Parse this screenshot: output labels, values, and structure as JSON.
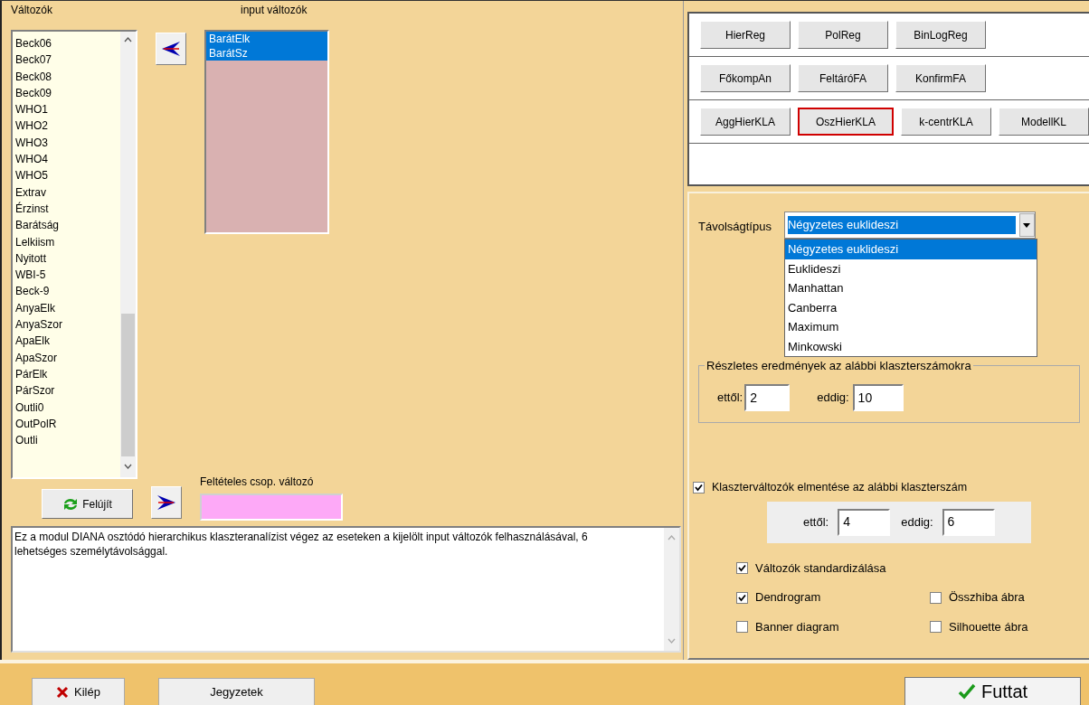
{
  "variables": {
    "label": "Változók",
    "items": [
      "Beck06",
      "Beck07",
      "Beck08",
      "Beck09",
      "WHO1",
      "WHO2",
      "WHO3",
      "WHO4",
      "WHO5",
      "Extrav",
      "Érzinst",
      "Barátság",
      "Lelkiism",
      "Nyitott",
      "WBI-5",
      "Beck-9",
      "AnyaElk",
      "AnyaSzor",
      "ApaElk",
      "ApaSzor",
      "PárElk",
      "PárSzor",
      "Outli0",
      "OutPolR",
      "Outli"
    ]
  },
  "input_variables": {
    "label": "input változók",
    "items": [
      {
        "text": "BarátElk",
        "selected": true
      },
      {
        "text": "BarátSz",
        "selected": true
      }
    ]
  },
  "condition": {
    "label": "Feltételes csop. változó"
  },
  "refresh_button": "Felújít",
  "description": "Ez a modul DIANA osztódó hierarchikus klaszteranalízist végez az eseteken a kijelölt input változók felhasználásával, 6 lehetséges személytávolsággal.",
  "module_rows": [
    [
      {
        "label": "HierReg",
        "selected": false
      },
      {
        "label": "PolReg",
        "selected": false
      },
      {
        "label": "BinLogReg",
        "selected": false
      }
    ],
    [
      {
        "label": "FőkompAn",
        "selected": false
      },
      {
        "label": "FeltáróFA",
        "selected": false
      },
      {
        "label": "KonfirmFA",
        "selected": false
      }
    ],
    [
      {
        "label": "AggHierKLA",
        "selected": false
      },
      {
        "label": "OszHierKLA",
        "selected": true
      },
      {
        "label": "k-centrKLA",
        "selected": false
      },
      {
        "label": "ModellKL",
        "selected": false
      }
    ]
  ],
  "distance": {
    "label": "Távolságtípus",
    "value": "Négyzetes euklideszi",
    "expanded": true,
    "options": [
      {
        "label": "Négyzetes euklideszi",
        "selected": true
      },
      {
        "label": "Euklideszi",
        "selected": false
      },
      {
        "label": "Manhattan",
        "selected": false
      },
      {
        "label": "Canberra",
        "selected": false
      },
      {
        "label": "Maximum",
        "selected": false
      },
      {
        "label": "Minkowski",
        "selected": false
      }
    ]
  },
  "details_group": {
    "title": "Részletes eredmények az alábbi klaszterszámokra",
    "from_label": "ettől:",
    "from": "2",
    "to_label": "eddig:",
    "to": "10"
  },
  "save_vars": {
    "label": "Klaszterváltozók elmentése az alábbi klaszterszám",
    "checked": true,
    "from_label": "ettől:",
    "from": "4",
    "to_label": "eddig:",
    "to": "6"
  },
  "option_rows": [
    [
      {
        "label": "Változók standardizálása",
        "checked": true
      }
    ],
    [
      {
        "label": "Dendrogram",
        "checked": true
      },
      {
        "label": "Összhiba ábra",
        "checked": false
      }
    ],
    [
      {
        "label": "Banner diagram",
        "checked": false
      },
      {
        "label": "Silhouette ábra",
        "checked": false
      }
    ]
  ],
  "footer": {
    "exit": "Kilép",
    "notes": "Jegyzetek",
    "run": "Futtat"
  }
}
